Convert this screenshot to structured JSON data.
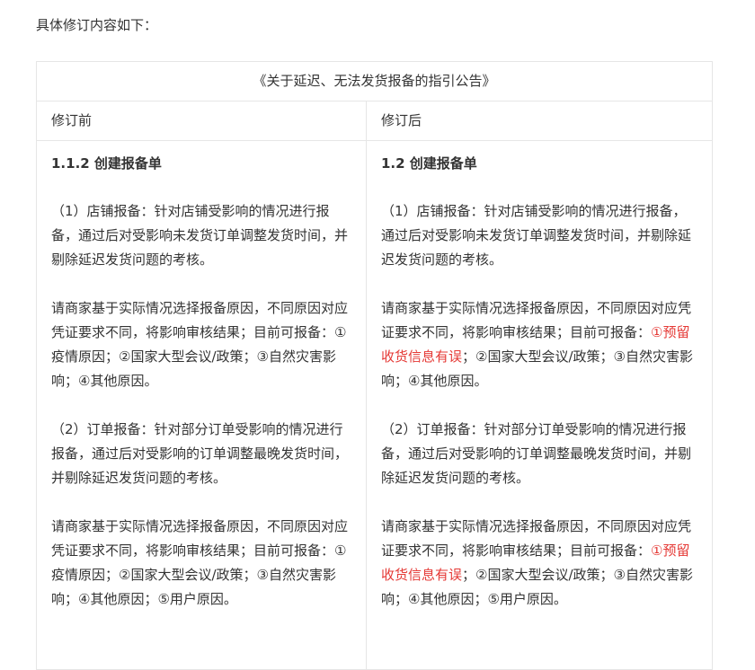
{
  "intro": "具体修订内容如下：",
  "table": {
    "title": "《关于延迟、无法发货报备的指引公告》",
    "col_before": "修订前",
    "col_after": "修订后",
    "before": {
      "heading": "1.1.2 创建报备单",
      "p1": "（1）店铺报备：针对店铺受影响的情况进行报备，通过后对受影响未发货订单调整发货时间，并剔除延迟发货问题的考核。",
      "p2": "请商家基于实际情况选择报备原因，不同原因对应凭证要求不同，将影响审核结果；目前可报备：①疫情原因；②国家大型会议/政策；③自然灾害影响；④其他原因。",
      "p3": "（2）订单报备：针对部分订单受影响的情况进行报备，通过后对受影响的订单调整最晚发货时间，并剔除延迟发货问题的考核。",
      "p4": "请商家基于实际情况选择报备原因，不同原因对应凭证要求不同，将影响审核结果；目前可报备：①疫情原因；②国家大型会议/政策；③自然灾害影响；④其他原因；⑤用户原因。"
    },
    "after": {
      "heading": "1.2 创建报备单",
      "p1": "（1）店铺报备：针对店铺受影响的情况进行报备，通过后对受影响未发货订单调整发货时间，并剔除延迟发货问题的考核。",
      "p2_pre": "请商家基于实际情况选择报备原因，不同原因对应凭证要求不同，将影响审核结果；目前可报备：",
      "p2_red": "①预留收货信息有误",
      "p2_post": "；②国家大型会议/政策；③自然灾害影响；④其他原因。",
      "p3": "（2）订单报备：针对部分订单受影响的情况进行报备，通过后对受影响的订单调整最晚发货时间，并剔除延迟发货问题的考核。",
      "p4_pre": "请商家基于实际情况选择报备原因，不同原因对应凭证要求不同，将影响审核结果；目前可报备：",
      "p4_red": "①预留收货信息有误",
      "p4_post": "；②国家大型会议/政策；③自然灾害影响；④其他原因；⑤用户原因。"
    }
  },
  "colors": {
    "highlight": "#e53935",
    "border": "#e6e6e6",
    "text": "#333333"
  }
}
